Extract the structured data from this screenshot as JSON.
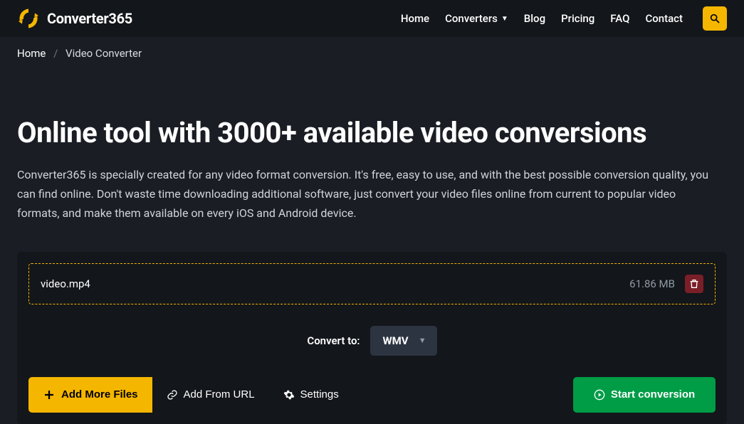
{
  "header": {
    "logo_text": "Converter365",
    "nav": {
      "home": "Home",
      "converters": "Converters",
      "blog": "Blog",
      "pricing": "Pricing",
      "faq": "FAQ",
      "contact": "Contact"
    }
  },
  "breadcrumbs": {
    "home": "Home",
    "current": "Video Converter"
  },
  "page": {
    "headline": "Online tool with 3000+ available video conversions",
    "description": "Converter365 is specially created for any video format conversion. It's free, easy to use, and with the best possible conversion quality, you can find online. Don't waste time downloading additional software, just convert your video files online from current to popular video formats, and make them available on every iOS and Android device."
  },
  "converter": {
    "file": {
      "name": "video.mp4",
      "size": "61.86 MB"
    },
    "convert_to_label": "Convert to:",
    "selected_format": "WMV",
    "buttons": {
      "add_more": "Add More Files",
      "add_url": "Add From URL",
      "settings": "Settings",
      "start": "Start conversion"
    }
  }
}
